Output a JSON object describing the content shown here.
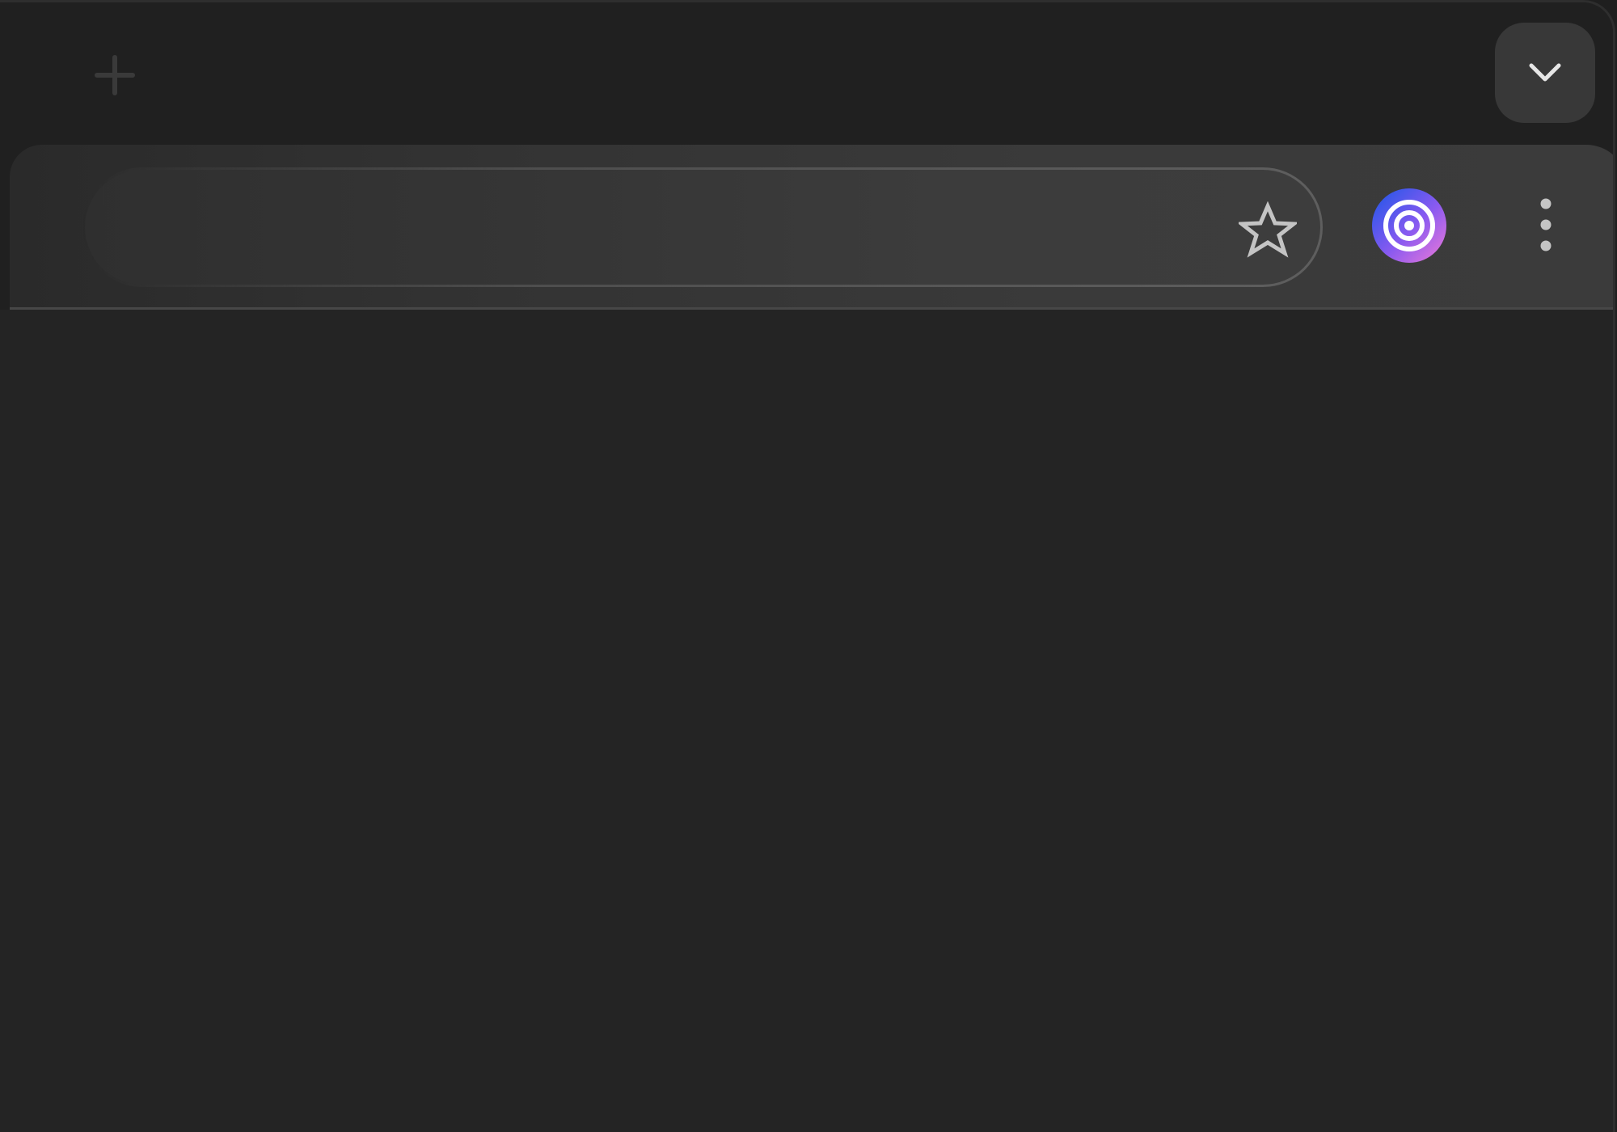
{
  "tabstrip": {
    "new_tab": {
      "icon": "plus-icon",
      "color": "#3a3a3a"
    },
    "tab_search": {
      "icon": "chevron-down-icon",
      "background": "#383838",
      "color": "#e6e6e6"
    }
  },
  "toolbar": {
    "omnibox": {
      "value": "",
      "placeholder": ""
    },
    "bookmark": {
      "icon": "star-outline-icon",
      "color": "#c4c4c4"
    },
    "profile": {
      "icon": "concentric-rings-icon",
      "gradient": [
        "#1a56e8",
        "#f07ad8"
      ]
    },
    "menu": {
      "icon": "vertical-dots-icon",
      "color": "#c4c4c4"
    }
  },
  "colors": {
    "window_bg": "#202020",
    "toolbar_bg": "#3b3b3b",
    "content_bg": "#242424"
  }
}
